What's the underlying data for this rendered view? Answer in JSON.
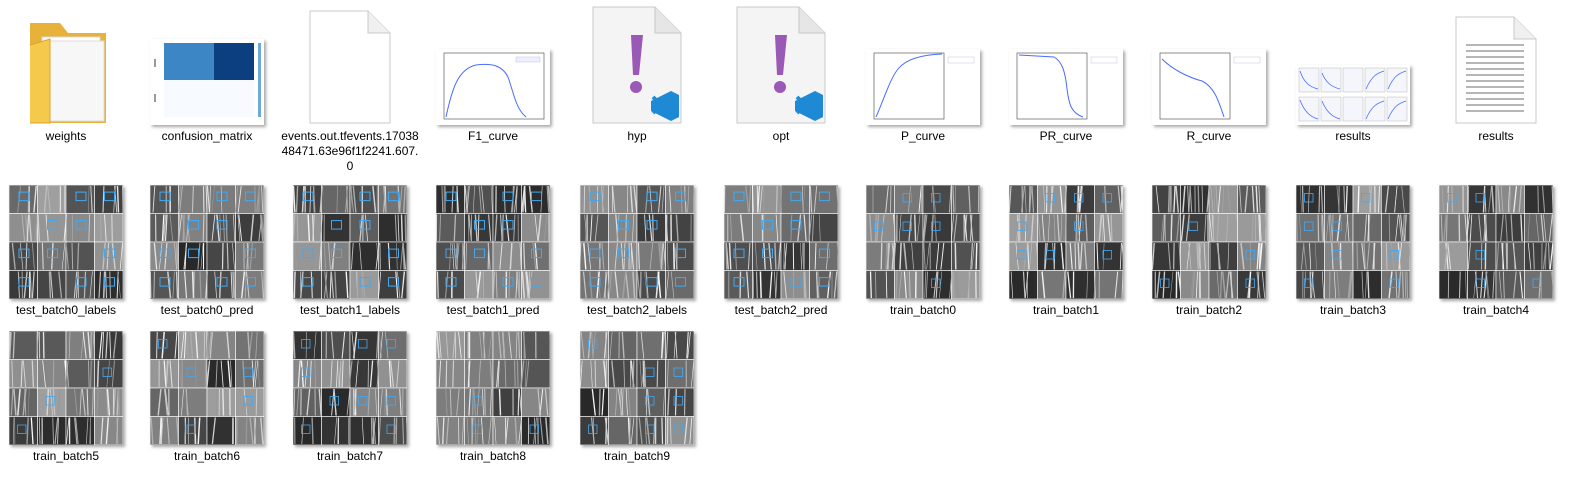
{
  "files": {
    "row1": [
      {
        "name": "weights",
        "type": "folder"
      },
      {
        "name": "confusion_matrix",
        "type": "image"
      },
      {
        "name": "events.out.tfevents.1703848471.63e96f1f2241.607.0",
        "type": "file"
      },
      {
        "name": "F1_curve",
        "type": "image"
      },
      {
        "name": "hyp",
        "type": "vscode-file"
      },
      {
        "name": "opt",
        "type": "vscode-file"
      },
      {
        "name": "P_curve",
        "type": "image"
      },
      {
        "name": "PR_curve",
        "type": "image"
      },
      {
        "name": "R_curve",
        "type": "image"
      },
      {
        "name": "results",
        "type": "image"
      },
      {
        "name": "results",
        "type": "text-file"
      }
    ],
    "row2": [
      {
        "name": "test_batch0_labels",
        "type": "image"
      },
      {
        "name": "test_batch0_pred",
        "type": "image"
      },
      {
        "name": "test_batch1_labels",
        "type": "image"
      },
      {
        "name": "test_batch1_pred",
        "type": "image"
      },
      {
        "name": "test_batch2_labels",
        "type": "image"
      },
      {
        "name": "test_batch2_pred",
        "type": "image"
      },
      {
        "name": "train_batch0",
        "type": "image"
      },
      {
        "name": "train_batch1",
        "type": "image"
      },
      {
        "name": "train_batch2",
        "type": "image"
      },
      {
        "name": "train_batch3",
        "type": "image"
      },
      {
        "name": "train_batch4",
        "type": "image"
      }
    ],
    "row3": [
      {
        "name": "train_batch5",
        "type": "image"
      },
      {
        "name": "train_batch6",
        "type": "image"
      },
      {
        "name": "train_batch7",
        "type": "image"
      },
      {
        "name": "train_batch8",
        "type": "image"
      },
      {
        "name": "train_batch9",
        "type": "image"
      }
    ]
  },
  "colors": {
    "folder": "#f5c94c",
    "vscode_blue": "#1e8ad6",
    "exclamation_purple": "#9b59b6",
    "plot_line": "#4a6cff",
    "detection_box": "#3fa9f5"
  }
}
